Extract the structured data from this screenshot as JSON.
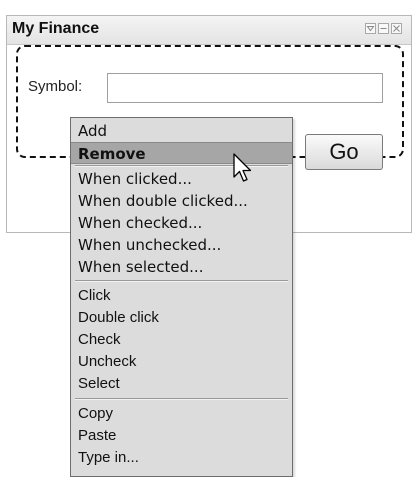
{
  "widget": {
    "title": "My Finance",
    "window_buttons": [
      "dropdown-icon",
      "minimize-icon",
      "close-icon"
    ]
  },
  "form": {
    "symbol_label": "Symbol:",
    "symbol_value": "",
    "go_label": "Go"
  },
  "context_menu": {
    "groups": [
      [
        "Add",
        "Remove"
      ],
      [
        "When clicked...",
        "When double clicked...",
        "When checked...",
        "When unchecked...",
        "When selected..."
      ],
      [
        "Click",
        "Double click",
        "Check",
        "Uncheck",
        "Select"
      ],
      [
        "Copy",
        "Paste",
        "Type in..."
      ]
    ],
    "highlighted": "Remove"
  },
  "cursor": "arrow-cursor-icon",
  "colors": {
    "menu_background": "#dcdcdc",
    "menu_highlight": "#a6a6a6"
  }
}
